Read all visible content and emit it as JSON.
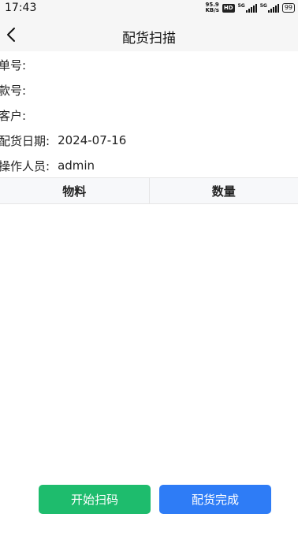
{
  "status_bar": {
    "time": "17:43",
    "net_speed_value": "95.9",
    "net_speed_unit": "KB/s",
    "hd_label": "HD",
    "signal_1_label": "5G",
    "signal_2_label": "5G",
    "battery": "99"
  },
  "header": {
    "title": "配货扫描",
    "back_icon": "chevron-left-icon"
  },
  "info": {
    "order_no_label": "单号:",
    "order_no_value": "",
    "style_no_label": "款号:",
    "style_no_value": "",
    "customer_label": "客户:",
    "customer_value": "",
    "date_label": "配货日期:",
    "date_value": "2024-07-16",
    "operator_label": "操作人员:",
    "operator_value": "admin"
  },
  "table": {
    "columns": [
      "物料",
      "数量"
    ],
    "rows": []
  },
  "actions": {
    "start_scan_label": "开始扫码",
    "finish_label": "配货完成"
  },
  "colors": {
    "start_button": "#1ebc6d",
    "finish_button": "#2e7cf6",
    "header_bg": "#f6f6f6"
  }
}
